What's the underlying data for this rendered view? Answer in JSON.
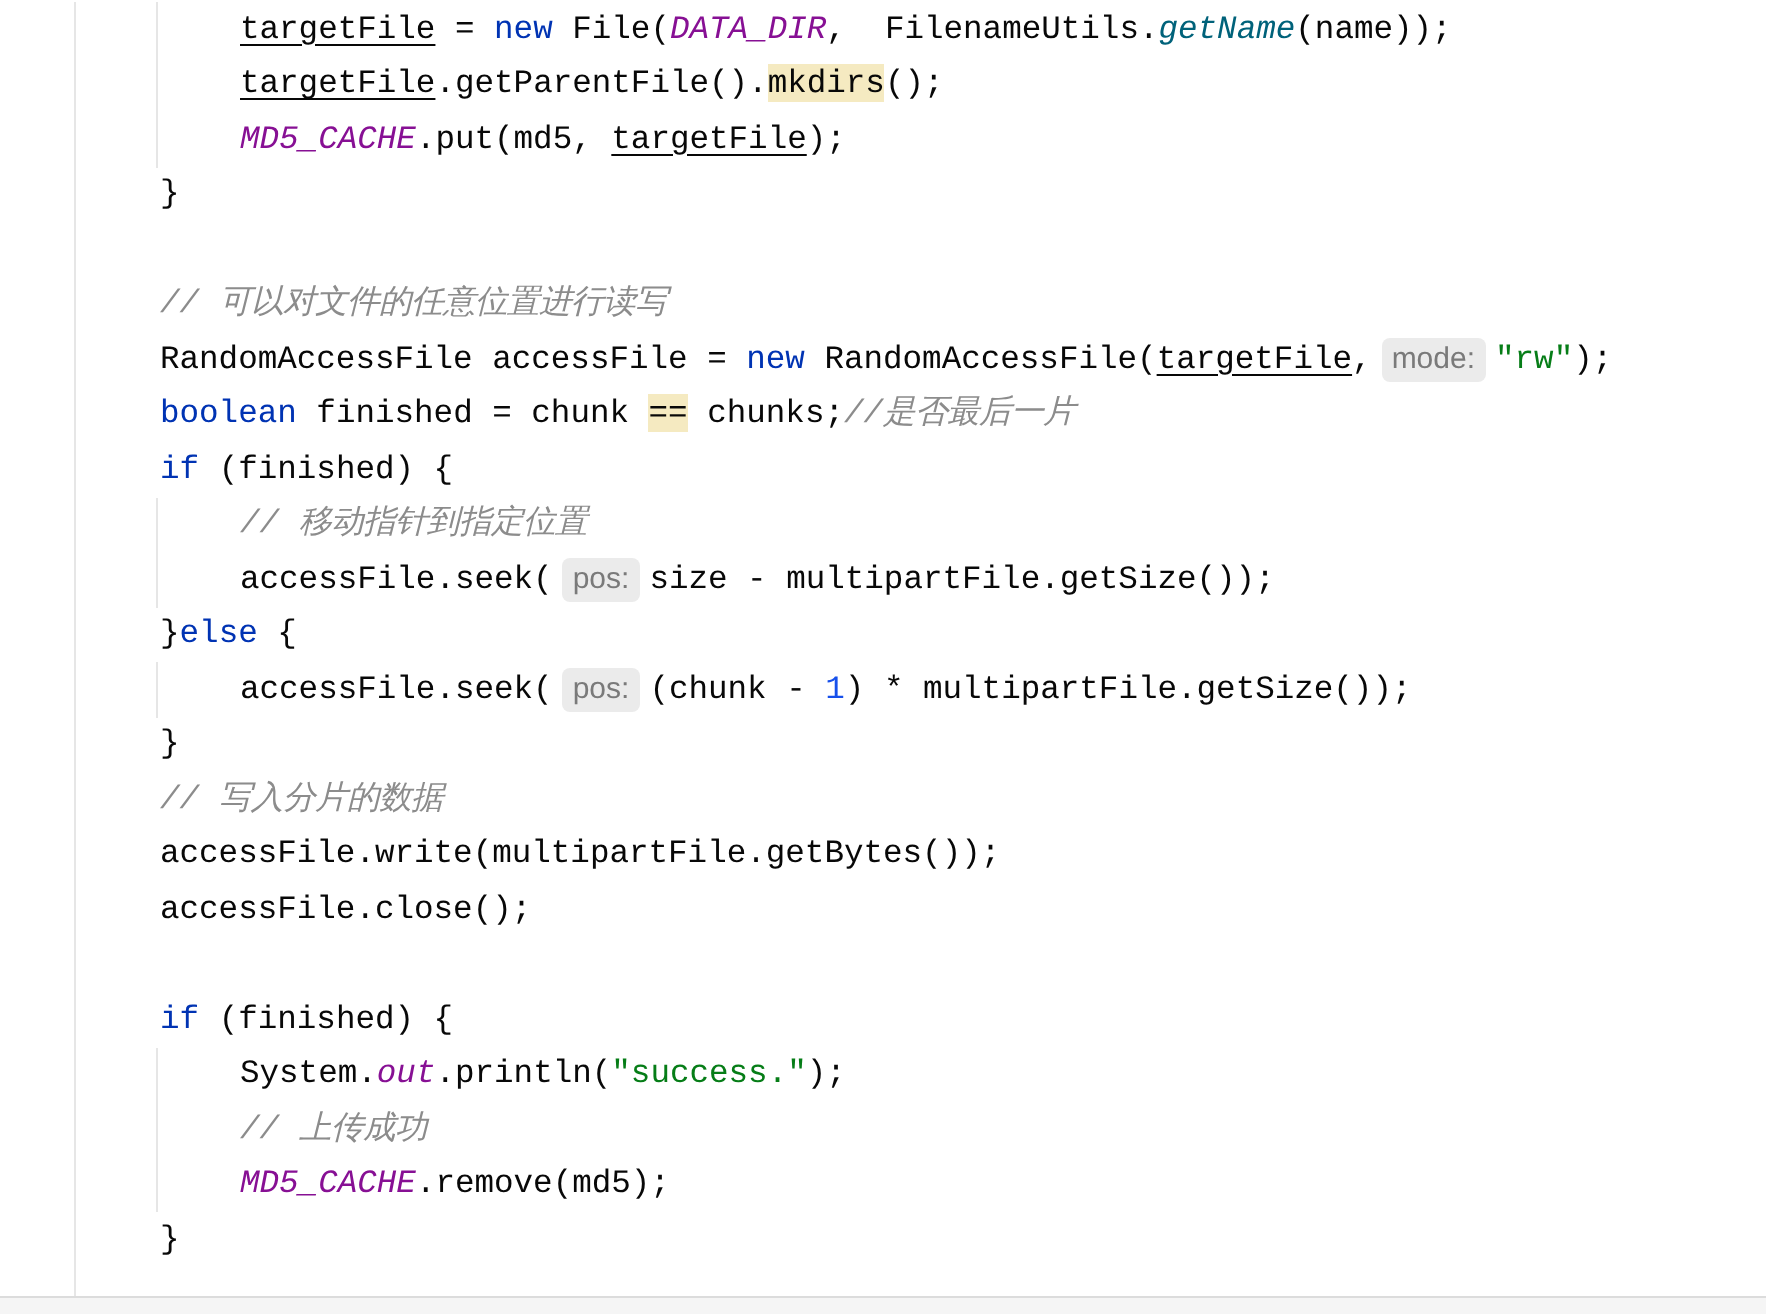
{
  "editor": {
    "body": [
      {
        "kind": "block",
        "children": [
          {
            "kind": "line",
            "segments": [
              {
                "kind": "code",
                "tokens": [
                  {
                    "kind": "underline",
                    "text": "targetFile"
                  },
                  {
                    "kind": "plain",
                    "text": " = "
                  },
                  {
                    "kind": "keyword",
                    "text": "new"
                  },
                  {
                    "kind": "plain",
                    "text": " File("
                  },
                  {
                    "kind": "constant",
                    "text": "DATA_DIR"
                  },
                  {
                    "kind": "plain",
                    "text": ",  FilenameUtils."
                  },
                  {
                    "kind": "static",
                    "text": "getName"
                  },
                  {
                    "kind": "plain",
                    "text": "(name));"
                  }
                ]
              }
            ]
          },
          {
            "kind": "line",
            "segments": [
              {
                "kind": "code",
                "tokens": [
                  {
                    "kind": "underline",
                    "text": "targetFile"
                  },
                  {
                    "kind": "plain",
                    "text": ".getParentFile()."
                  },
                  {
                    "kind": "highlight",
                    "text": "mkdirs"
                  },
                  {
                    "kind": "plain",
                    "text": "();"
                  }
                ]
              }
            ]
          },
          {
            "kind": "line",
            "segments": [
              {
                "kind": "code",
                "tokens": [
                  {
                    "kind": "constant",
                    "text": "MD5_CACHE"
                  },
                  {
                    "kind": "plain",
                    "text": ".put(md5, "
                  },
                  {
                    "kind": "underline",
                    "text": "targetFile"
                  },
                  {
                    "kind": "plain",
                    "text": ");"
                  }
                ]
              }
            ]
          }
        ]
      },
      {
        "kind": "line",
        "segments": [
          {
            "kind": "code",
            "tokens": [
              {
                "kind": "plain",
                "text": "}"
              }
            ]
          }
        ]
      },
      {
        "kind": "blank"
      },
      {
        "kind": "line",
        "segments": [
          {
            "kind": "code",
            "tokens": [
              {
                "kind": "comment",
                "text": "// 可以对文件的任意位置进行读写"
              }
            ]
          }
        ]
      },
      {
        "kind": "line",
        "segments": [
          {
            "kind": "code",
            "tokens": [
              {
                "kind": "plain",
                "text": "RandomAccessFile accessFile = "
              },
              {
                "kind": "keyword",
                "text": "new"
              },
              {
                "kind": "plain",
                "text": " RandomAccessFile("
              },
              {
                "kind": "underline",
                "text": "targetFile"
              },
              {
                "kind": "plain",
                "text": ","
              }
            ]
          },
          {
            "kind": "hint",
            "text": "mode:"
          },
          {
            "kind": "code",
            "tokens": [
              {
                "kind": "string",
                "text": "\"rw\""
              },
              {
                "kind": "plain",
                "text": ");"
              }
            ]
          }
        ]
      },
      {
        "kind": "line",
        "segments": [
          {
            "kind": "code",
            "tokens": [
              {
                "kind": "keyword",
                "text": "boolean"
              },
              {
                "kind": "plain",
                "text": " finished = chunk "
              },
              {
                "kind": "highlight",
                "text": "=="
              },
              {
                "kind": "plain",
                "text": " chunks;"
              },
              {
                "kind": "comment",
                "text": "//是否最后一片"
              }
            ]
          }
        ]
      },
      {
        "kind": "line",
        "segments": [
          {
            "kind": "code",
            "tokens": [
              {
                "kind": "keyword",
                "text": "if"
              },
              {
                "kind": "plain",
                "text": " (finished) {"
              }
            ]
          }
        ]
      },
      {
        "kind": "block",
        "children": [
          {
            "kind": "line",
            "segments": [
              {
                "kind": "code",
                "tokens": [
                  {
                    "kind": "comment",
                    "text": "// 移动指针到指定位置"
                  }
                ]
              }
            ]
          },
          {
            "kind": "line",
            "segments": [
              {
                "kind": "code",
                "tokens": [
                  {
                    "kind": "plain",
                    "text": "accessFile.seek("
                  }
                ]
              },
              {
                "kind": "hint",
                "text": "pos:"
              },
              {
                "kind": "code",
                "tokens": [
                  {
                    "kind": "plain",
                    "text": "size - multipartFile.getSize());"
                  }
                ]
              }
            ]
          }
        ]
      },
      {
        "kind": "line",
        "segments": [
          {
            "kind": "code",
            "tokens": [
              {
                "kind": "plain",
                "text": "}"
              },
              {
                "kind": "keyword",
                "text": "else"
              },
              {
                "kind": "plain",
                "text": " {"
              }
            ]
          }
        ]
      },
      {
        "kind": "block",
        "children": [
          {
            "kind": "line",
            "segments": [
              {
                "kind": "code",
                "tokens": [
                  {
                    "kind": "plain",
                    "text": "accessFile.seek("
                  }
                ]
              },
              {
                "kind": "hint",
                "text": "pos:"
              },
              {
                "kind": "code",
                "tokens": [
                  {
                    "kind": "plain",
                    "text": "(chunk - "
                  },
                  {
                    "kind": "number",
                    "text": "1"
                  },
                  {
                    "kind": "plain",
                    "text": ") * multipartFile.getSize());"
                  }
                ]
              }
            ]
          }
        ]
      },
      {
        "kind": "line",
        "segments": [
          {
            "kind": "code",
            "tokens": [
              {
                "kind": "plain",
                "text": "}"
              }
            ]
          }
        ]
      },
      {
        "kind": "line",
        "segments": [
          {
            "kind": "code",
            "tokens": [
              {
                "kind": "comment",
                "text": "// 写入分片的数据"
              }
            ]
          }
        ]
      },
      {
        "kind": "line",
        "segments": [
          {
            "kind": "code",
            "tokens": [
              {
                "kind": "plain",
                "text": "accessFile.write(multipartFile.getBytes());"
              }
            ]
          }
        ]
      },
      {
        "kind": "line",
        "segments": [
          {
            "kind": "code",
            "tokens": [
              {
                "kind": "plain",
                "text": "accessFile.close();"
              }
            ]
          }
        ]
      },
      {
        "kind": "blank"
      },
      {
        "kind": "line",
        "segments": [
          {
            "kind": "code",
            "tokens": [
              {
                "kind": "keyword",
                "text": "if"
              },
              {
                "kind": "plain",
                "text": " (finished) {"
              }
            ]
          }
        ]
      },
      {
        "kind": "block",
        "children": [
          {
            "kind": "line",
            "segments": [
              {
                "kind": "code",
                "tokens": [
                  {
                    "kind": "plain",
                    "text": "System."
                  },
                  {
                    "kind": "constant",
                    "text": "out"
                  },
                  {
                    "kind": "plain",
                    "text": ".println("
                  },
                  {
                    "kind": "string",
                    "text": "\"success.\""
                  },
                  {
                    "kind": "plain",
                    "text": ");"
                  }
                ]
              }
            ]
          },
          {
            "kind": "line",
            "segments": [
              {
                "kind": "code",
                "tokens": [
                  {
                    "kind": "comment",
                    "text": "// 上传成功"
                  }
                ]
              }
            ]
          },
          {
            "kind": "line",
            "segments": [
              {
                "kind": "code",
                "tokens": [
                  {
                    "kind": "constant",
                    "text": "MD5_CACHE"
                  },
                  {
                    "kind": "plain",
                    "text": ".remove(md5);"
                  }
                ]
              }
            ]
          }
        ]
      },
      {
        "kind": "line",
        "segments": [
          {
            "kind": "code",
            "tokens": [
              {
                "kind": "plain",
                "text": "}"
              }
            ]
          }
        ]
      }
    ]
  }
}
